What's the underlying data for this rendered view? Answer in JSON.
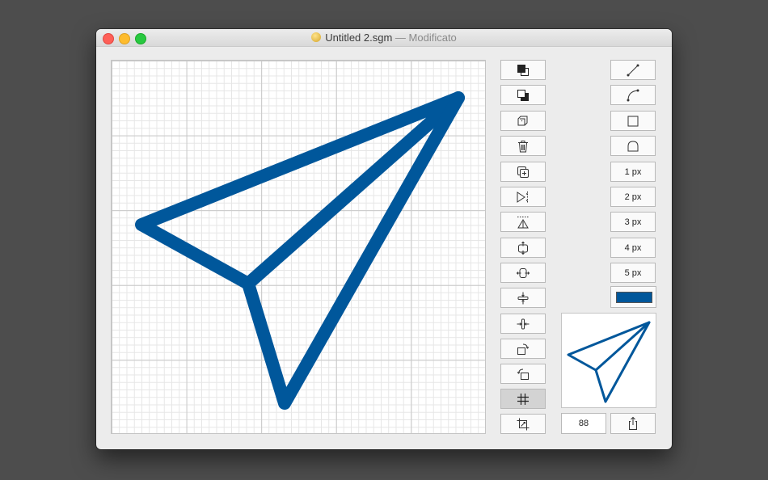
{
  "window": {
    "filename": "Untitled 2.sgm",
    "separator": " — ",
    "status": "Modificato"
  },
  "drawing": {
    "stroke_color": "#00579b",
    "shape": "paper-plane"
  },
  "stroke_widths": [
    "1 px",
    "2 px",
    "3 px",
    "4 px",
    "5 px"
  ],
  "zoom": "88",
  "tools": {
    "left_column": [
      "bring-to-front-icon",
      "send-to-back-icon",
      "duplicate-layers-icon",
      "trash-icon",
      "add-copy-icon",
      "flip-horizontal-icon",
      "flip-vertical-icon",
      "scale-vertical-icon",
      "scale-horizontal-icon",
      "compress-vertical-icon",
      "compress-horizontal-icon",
      "rotate-right-icon",
      "rotate-left-icon",
      "grid-icon",
      "crop-icon"
    ],
    "right_column": [
      "line-icon",
      "curve-icon",
      "rectangle-icon",
      "arch-icon"
    ],
    "active": "grid-icon"
  }
}
